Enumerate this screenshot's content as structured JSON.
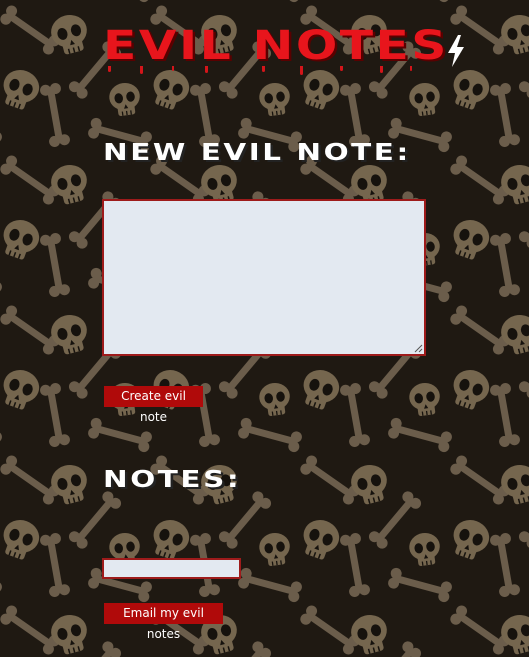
{
  "header": {
    "title": "Evil Notes",
    "icon": "lightning-bolt-icon"
  },
  "new_note": {
    "heading": "New evil note:",
    "textarea_value": "",
    "create_label": "Create evil note"
  },
  "notes": {
    "heading": "Notes:",
    "email_value": "",
    "email_label": "Email my evil notes"
  },
  "theme": {
    "background": "#2a2219",
    "title_red": "#e8151c",
    "button_red": "#b00a0a",
    "input_border": "#9e1b1b",
    "input_bg": "#e3e9f1",
    "background_pattern": "skulls-and-crossbones-icon"
  }
}
